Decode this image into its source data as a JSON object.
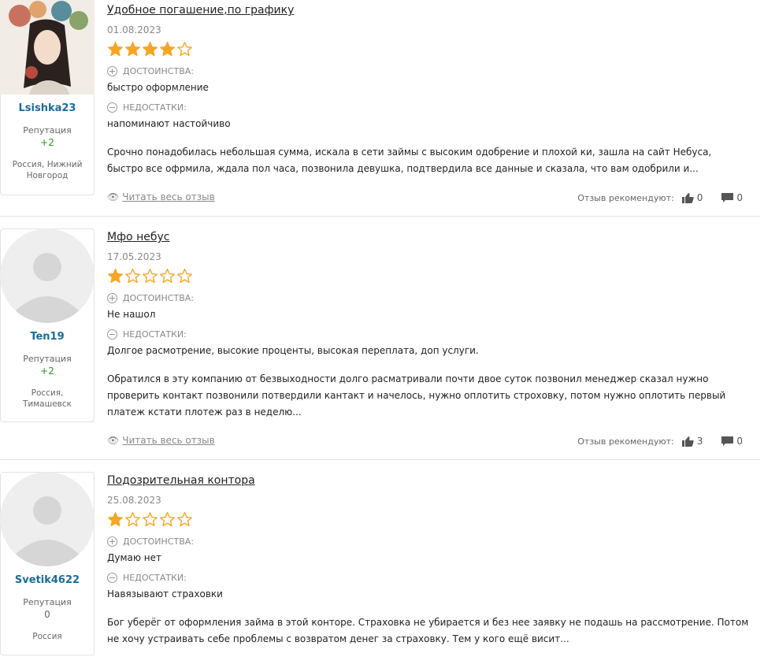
{
  "labels": {
    "pros": "ДОСТОИНСТВА:",
    "cons": "НЕДОСТАТКИ:",
    "reputation": "Репутация",
    "read_more": "Читать весь отзыв",
    "recommend": "Отзыв рекомендуют:"
  },
  "colors": {
    "star": "#f5a623",
    "link": "#1a6b9a",
    "positive": "#1f9d1f"
  },
  "reviews": [
    {
      "username": "Lsishka23",
      "reputation": "+2",
      "location": "Россия, Нижний Новгород",
      "title": "Удобное погашение,по графику",
      "date": "01.08.2023",
      "rating": 4,
      "pros": "быстро оформление",
      "cons": "напоминают настойчиво",
      "text": "Срочно понадобилась небольшая сумма, искала в сети займы с высоким одобрение и плохой ки, зашла на сайт Небуса, быстро все офрмила, ждала пол часа, позвонила девушка, подтвердила все данные и сказала, что вам одобрили и...",
      "likes": "0",
      "comments": "0"
    },
    {
      "username": "Ten19",
      "reputation": "+2",
      "location": "Россия, Тимашевск",
      "title": "Мфо небус",
      "date": "17.05.2023",
      "rating": 1,
      "pros": "Не нашол",
      "cons": "Долгое расмотрение, высокие проценты, высокая переплата, доп услуги.",
      "text": "Обратился в эту компанию от безвыходности долго расматривали почти двое суток позвонил менеджер сказал нужно проверить контакт позвонили потвердили кантакт и начелось, нужно оплотить строховку, потом нужно оплотить первый платеж кстати плотеж раз в неделю...",
      "likes": "3",
      "comments": "0"
    },
    {
      "username": "Svetik4622",
      "reputation": "0",
      "location": "Россия",
      "title": "Подозрительная контора",
      "date": "25.08.2023",
      "rating": 1,
      "pros": "Думаю нет",
      "cons": "Навязывают страховки",
      "text": "Бог уберёг от оформления займа в этой конторе. Страховка не убирается и без нее заявку не подашь на рассмотрение. Потом не хочу устраивать себе проблемы с возвратом денег за страховку. Тем у кого ещё висит..."
    }
  ]
}
